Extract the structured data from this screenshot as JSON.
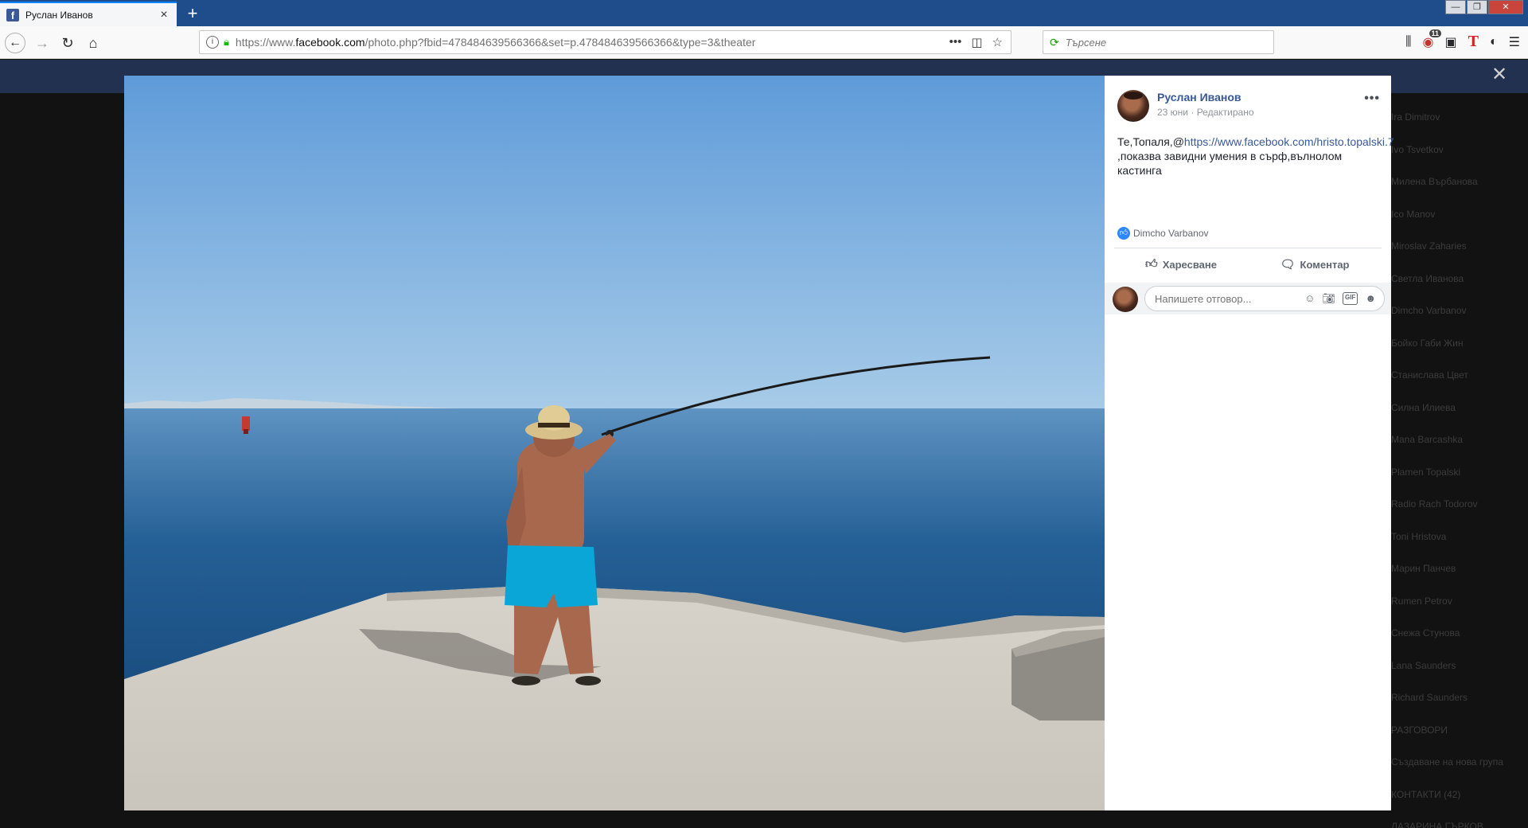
{
  "browser": {
    "tab_title": "Руслан Иванов",
    "tab_favicon": "f",
    "url_host": "https://www.",
    "url_domain": "facebook.com",
    "url_path": "/photo.php?fbid=478484639566366&set=p.478484639566366&type=3&theater",
    "search_placeholder": "Търсене",
    "notification_count": "11",
    "winctl": {
      "minimize": "—",
      "restore": "❐",
      "close": "✕"
    }
  },
  "theater": {
    "close_label": "✕",
    "post": {
      "author": "Руслан Иванов",
      "date": "23 юни",
      "edited": "Редактирано",
      "more": "•••",
      "text_prefix": "Те,Топаля,@",
      "link_text": "https://www.facebook.com/hristo.topalski.7",
      "text_suffix": " ,показва завидни умения в сърф,вълнолом кастинга",
      "reacted_by": "Dimcho Varbanov",
      "like_label": "Харесване",
      "comment_label": "Коментар",
      "reply_placeholder": "Напишете отговор...",
      "gif_label": "GIF"
    }
  },
  "chat_sidebar": {
    "items": [
      "Ira Dimitrov",
      "Ivo Tsvetkov",
      "Милена Върбанова",
      "Ico Manov",
      "Miroslav Zaharies",
      "Светла Иванова",
      "Dimcho Varbanov",
      "Бойко Габи Жин",
      "Станислава Цвет",
      "Силна Илиева",
      "Mana Barcashka",
      "Plamen Topalski",
      "Radio Rach Todorov",
      "Toni Hristova",
      "Марин Панчев",
      "Rumen Petrov",
      "Снежа Стунова",
      "Lana Saunders",
      "Richard Saunders",
      "РАЗГОВОРИ",
      "Създаване на нова група",
      "КОНТАКТИ (42)",
      "ЛАЗАРИНА ГЪРКОВ"
    ]
  }
}
